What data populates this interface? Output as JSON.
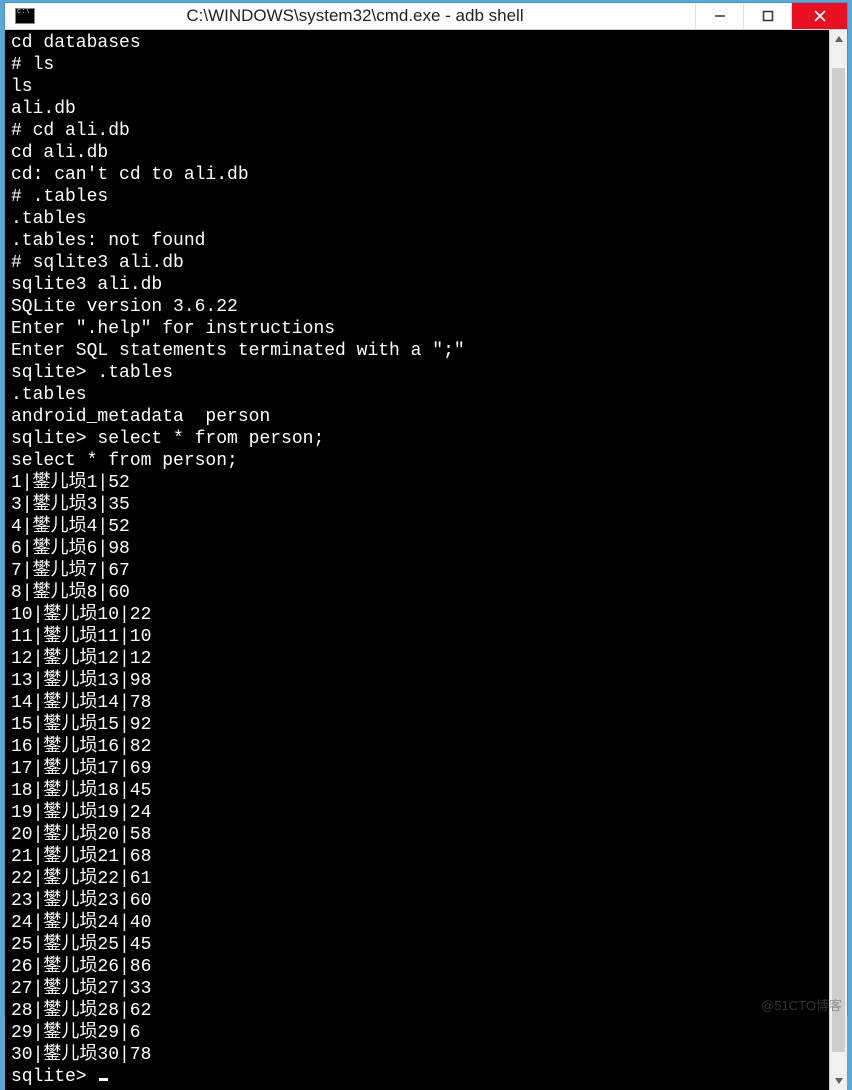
{
  "window": {
    "title": "C:\\WINDOWS\\system32\\cmd.exe - adb  shell"
  },
  "terminal": {
    "lines": [
      "cd databases",
      "# ls",
      "ls",
      "ali.db",
      "# cd ali.db",
      "cd ali.db",
      "cd: can't cd to ali.db",
      "# .tables",
      ".tables",
      ".tables: not found",
      "# sqlite3 ali.db",
      "sqlite3 ali.db",
      "SQLite version 3.6.22",
      "Enter \".help\" for instructions",
      "Enter SQL statements terminated with a \";\"",
      "sqlite> .tables",
      ".tables",
      "android_metadata  person",
      "sqlite> select * from person;",
      "select * from person;",
      "1|鐢儿埙1|52",
      "3|鐢儿埙3|35",
      "4|鐢儿埙4|52",
      "6|鐢儿埙6|98",
      "7|鐢儿埙7|67",
      "8|鐢儿埙8|60",
      "10|鐢儿埙10|22",
      "11|鐢儿埙11|10",
      "12|鐢儿埙12|12",
      "13|鐢儿埙13|98",
      "14|鐢儿埙14|78",
      "15|鐢儿埙15|92",
      "16|鐢儿埙16|82",
      "17|鐢儿埙17|69",
      "18|鐢儿埙18|45",
      "19|鐢儿埙19|24",
      "20|鐢儿埙20|58",
      "21|鐢儿埙21|68",
      "22|鐢儿埙22|61",
      "23|鐢儿埙23|60",
      "24|鐢儿埙24|40",
      "25|鐢儿埙25|45",
      "26|鐢儿埙26|86",
      "27|鐢儿埙27|33",
      "28|鐢儿埙28|62",
      "29|鐢儿埙29|6",
      "30|鐢儿埙30|78"
    ],
    "prompt": "sqlite> "
  },
  "watermark": "@51CTO博客"
}
